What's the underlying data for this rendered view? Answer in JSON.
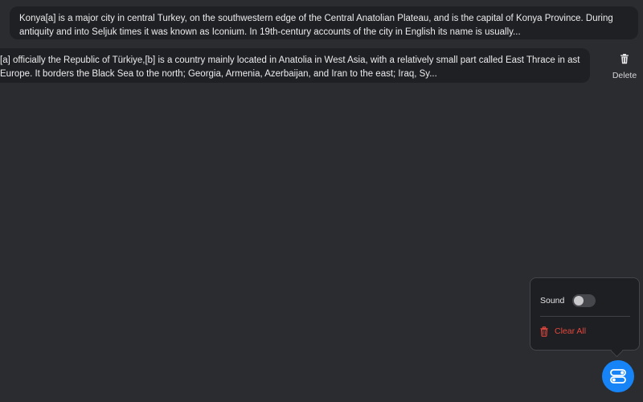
{
  "clips": [
    {
      "text": "Konya[a] is a major city in central Turkey, on the southwestern edge of the Central Anatolian Plateau, and is the capital of Konya Province. During antiquity and into Seljuk times it was known as Iconium. In 19th-century accounts of the city in English its name is usually..."
    },
    {
      "text": "[a] officially the Republic of Türkiye,[b] is a country mainly located in Anatolia in West Asia, with a relatively small part called East Thrace in ast Europe. It borders the Black Sea to the north; Georgia, Armenia, Azerbaijan, and Iran to the east; Iraq, Sy..."
    }
  ],
  "row_actions": {
    "delete_label": "Delete",
    "delete_icon": "trash-icon"
  },
  "settings_popover": {
    "sound_label": "Sound",
    "sound_enabled": false,
    "clear_all_label": "Clear All",
    "clear_all_icon": "trash-icon",
    "clear_all_color": "#e5483e"
  },
  "fab": {
    "icon": "toggles-icon",
    "color": "#1684f6"
  }
}
